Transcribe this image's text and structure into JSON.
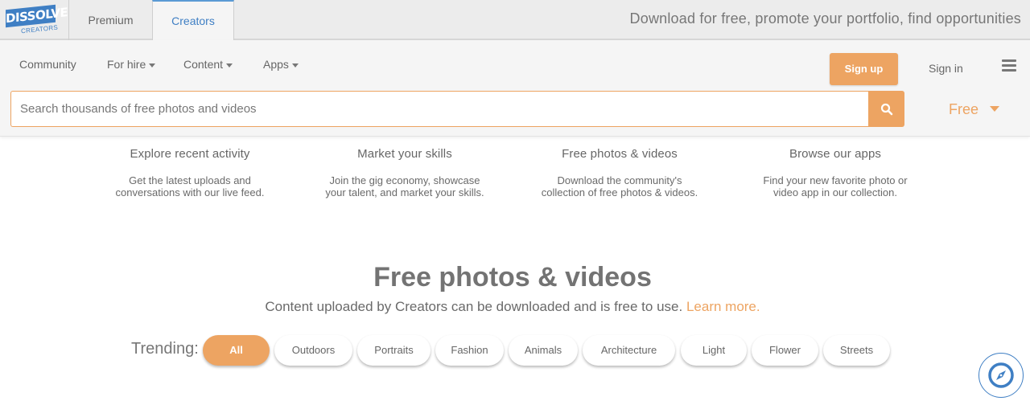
{
  "topbar": {
    "logo": {
      "brand": "DISSOLVE",
      "sub": "CREATORS"
    },
    "tabs": [
      {
        "label": "Premium",
        "active": false
      },
      {
        "label": "Creators",
        "active": true
      }
    ],
    "tagline": "Download for free, promote your portfolio, find opportunities"
  },
  "nav": {
    "items": [
      {
        "label": "Community",
        "has_dropdown": false
      },
      {
        "label": "For hire",
        "has_dropdown": true
      },
      {
        "label": "Content",
        "has_dropdown": true
      },
      {
        "label": "Apps",
        "has_dropdown": true
      }
    ],
    "signup_label": "Sign up",
    "signin_label": "Sign in",
    "menu_icon": "hamburger-icon"
  },
  "search": {
    "placeholder": "Search thousands of free photos and videos",
    "value": "",
    "button_icon": "search-icon",
    "filter_selected": "Free"
  },
  "features": [
    {
      "title": "Explore recent activity",
      "line1": "Get the latest uploads and",
      "line2": "conversations with our live feed."
    },
    {
      "title": "Market your skills",
      "line1": "Join the gig economy, showcase",
      "line2": "your talent, and market your skills."
    },
    {
      "title": "Free photos & videos",
      "line1": "Download the community's",
      "line2": "collection of free photos & videos."
    },
    {
      "title": "Browse our apps",
      "line1": "Find your new favorite photo or",
      "line2": "video app in our collection."
    }
  ],
  "hero": {
    "title": "Free photos & videos",
    "subtitle": "Content uploaded by Creators can be downloaded and is free to use.",
    "link": "Learn more."
  },
  "trending": {
    "label": "Trending:",
    "pills": [
      {
        "label": "All",
        "active": true
      },
      {
        "label": "Outdoors",
        "active": false
      },
      {
        "label": "Portraits",
        "active": false
      },
      {
        "label": "Fashion",
        "active": false
      },
      {
        "label": "Animals",
        "active": false
      },
      {
        "label": "Architecture",
        "active": false
      },
      {
        "label": "Light",
        "active": false
      },
      {
        "label": "Flower",
        "active": false
      },
      {
        "label": "Streets",
        "active": false
      }
    ]
  },
  "floating": {
    "icon": "compass-icon"
  },
  "colors": {
    "accent": "#eda462",
    "brand_blue": "#3f7fc4",
    "text": "#666666"
  }
}
